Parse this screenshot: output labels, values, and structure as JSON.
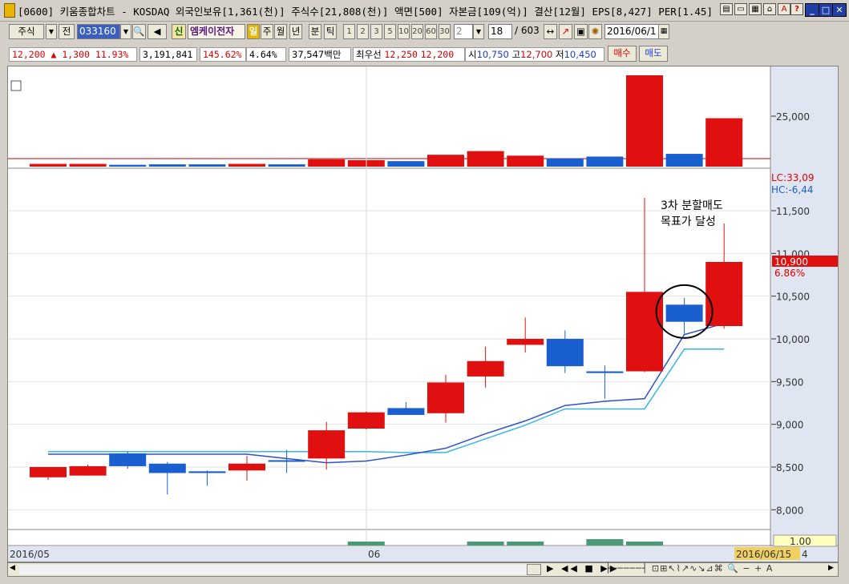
{
  "window": {
    "title": "[0600] 키움종합차트 - KOSDAQ 외국인보유[1,361(천)] 주식수[21,808(천)] 액면[500] 자본금[109(억)] 결산[12월] EPS[8,427] PER[1.45]",
    "buttons": [
      "minimize",
      "restore",
      "close"
    ]
  },
  "toolbar": {
    "market": "주식",
    "prev_label": "전",
    "code": "033160",
    "new_label": "신",
    "stock_name": "엠케이전자",
    "periods": [
      "일",
      "주",
      "월",
      "년",
      "분",
      "틱"
    ],
    "selected_period": "일",
    "intervals": [
      "1",
      "2",
      "3",
      "5",
      "10",
      "20",
      "60",
      "30"
    ],
    "interval_input": "2",
    "count": "18",
    "total": "/ 603",
    "date": "2016/06/1"
  },
  "quote": {
    "price": "12,200",
    "change": "▲ 1,300",
    "change_pct": "11.93%",
    "volume": "3,191,841",
    "volume_ratio": "145.62%",
    "turnover": "4.64%",
    "amount": "37,547백만",
    "best_label": "최우선",
    "best_ask": "12,250",
    "best_bid": "12,200",
    "open_label": "시",
    "open": "10,750",
    "high_label": "고",
    "high": "12,700",
    "low_label": "저",
    "low": "10,450",
    "buy_button": "매수",
    "sell_button": "매도"
  },
  "chart_data": {
    "type": "candlestick",
    "dates_labels": [
      "2016/05",
      "06"
    ],
    "current_date": "2016/06/15",
    "x_axis_suffix": "4",
    "price_axis_ticks": [
      8000,
      8500,
      9000,
      9500,
      10000,
      10500,
      11000,
      11500
    ],
    "price_ylim": [
      7750,
      11950
    ],
    "volume_axis_tick": "25,000",
    "indicator_labels": [
      "LC:33,09",
      "HC:-6,44"
    ],
    "current_price_label": "10,900",
    "current_pct_label": "6.86%",
    "bottom_panel_value": "1.00",
    "annotation": [
      "3차 분할매도",
      "목표가 달성"
    ],
    "candles": [
      {
        "o": 8500,
        "h": 8500,
        "l": 8350,
        "c": 8380,
        "up": true
      },
      {
        "o": 8510,
        "h": 8530,
        "l": 8400,
        "c": 8400,
        "up": true
      },
      {
        "o": 8660,
        "h": 8680,
        "l": 8480,
        "c": 8510,
        "up": false
      },
      {
        "o": 8540,
        "h": 8560,
        "l": 8180,
        "c": 8430,
        "up": false
      },
      {
        "o": 8450,
        "h": 8460,
        "l": 8280,
        "c": 8430,
        "up": false
      },
      {
        "o": 8460,
        "h": 8630,
        "l": 8340,
        "c": 8540,
        "up": true
      },
      {
        "o": 8580,
        "h": 8700,
        "l": 8430,
        "c": 8570,
        "up": false
      },
      {
        "o": 8600,
        "h": 9030,
        "l": 8470,
        "c": 8930,
        "up": true
      },
      {
        "o": 8950,
        "h": 9150,
        "l": 8940,
        "c": 9140,
        "up": true
      },
      {
        "o": 9190,
        "h": 9260,
        "l": 9110,
        "c": 9110,
        "up": false
      },
      {
        "o": 9130,
        "h": 9580,
        "l": 9020,
        "c": 9490,
        "up": true
      },
      {
        "o": 9560,
        "h": 9910,
        "l": 9430,
        "c": 9740,
        "up": true
      },
      {
        "o": 9930,
        "h": 10250,
        "l": 9840,
        "c": 10000,
        "up": true
      },
      {
        "o": 10000,
        "h": 10100,
        "l": 9600,
        "c": 9680,
        "up": false
      },
      {
        "o": 9620,
        "h": 9690,
        "l": 9300,
        "c": 9600,
        "up": false
      },
      {
        "o": 9620,
        "h": 11650,
        "l": 9610,
        "c": 10550,
        "up": true
      },
      {
        "o": 10400,
        "h": 10480,
        "l": 10060,
        "c": 10200,
        "up": false
      },
      {
        "o": 10150,
        "h": 11350,
        "l": 10120,
        "c": 10900,
        "up": true
      }
    ],
    "volume_series": [
      {
        "v": 0.03,
        "up": true
      },
      {
        "v": 0.03,
        "up": true
      },
      {
        "v": 0.02,
        "up": false
      },
      {
        "v": 0.025,
        "up": false
      },
      {
        "v": 0.025,
        "up": false
      },
      {
        "v": 0.03,
        "up": true
      },
      {
        "v": 0.025,
        "up": false
      },
      {
        "v": 0.08,
        "up": true
      },
      {
        "v": 0.07,
        "up": true
      },
      {
        "v": 0.06,
        "up": false
      },
      {
        "v": 0.13,
        "up": true
      },
      {
        "v": 0.17,
        "up": true
      },
      {
        "v": 0.12,
        "up": true
      },
      {
        "v": 0.09,
        "up": false
      },
      {
        "v": 0.11,
        "up": false
      },
      {
        "v": 1.0,
        "up": true
      },
      {
        "v": 0.14,
        "up": false
      },
      {
        "v": 0.53,
        "up": true
      }
    ],
    "line_dark": [
      8650,
      8650,
      8650,
      8650,
      8650,
      8650,
      8600,
      8550,
      8570,
      8640,
      8720,
      8890,
      9040,
      9220,
      9270,
      9300,
      10050,
      10180
    ],
    "line_light": [
      8680,
      8680,
      8680,
      8680,
      8680,
      8680,
      8680,
      8680,
      8680,
      8670,
      8670,
      8830,
      8990,
      9180,
      9180,
      9180,
      9880,
      9880
    ],
    "colors": {
      "up": "#e01010",
      "down": "#1a5fd0",
      "line_dark": "#3050c8",
      "line_light": "#39b6e8",
      "osc": "#4a9a7a"
    }
  }
}
